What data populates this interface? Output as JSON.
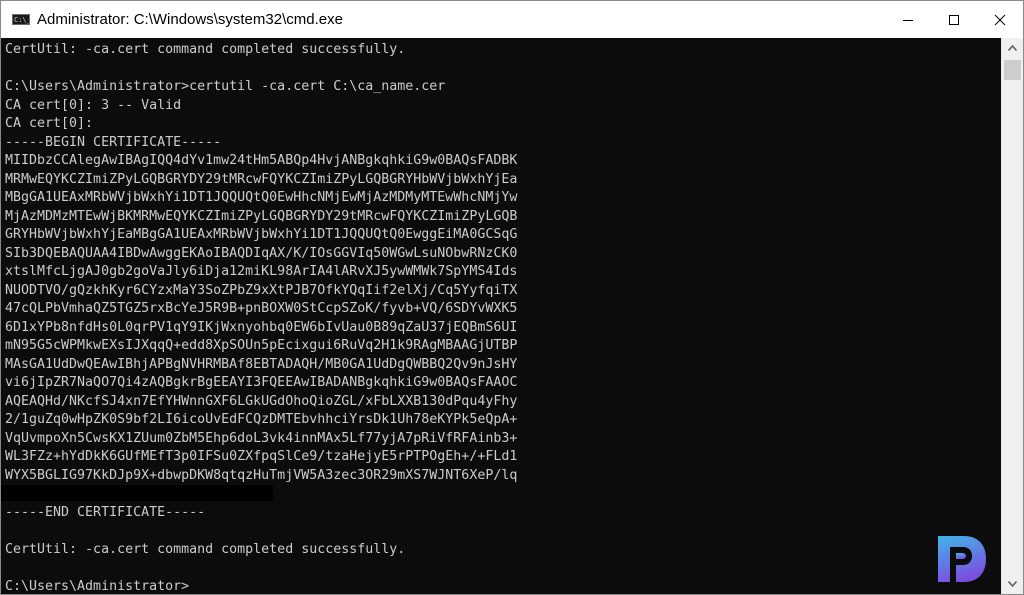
{
  "window": {
    "title": "Administrator: C:\\Windows\\system32\\cmd.exe",
    "app_icon_label": "C:\\_",
    "controls": {
      "minimize": "minimize-icon",
      "maximize": "maximize-icon",
      "close": "close-icon"
    }
  },
  "console": {
    "lines": [
      "CertUtil: -ca.cert command completed successfully.",
      "",
      "C:\\Users\\Administrator>certutil -ca.cert C:\\ca_name.cer",
      "CA cert[0]: 3 -- Valid",
      "CA cert[0]:",
      "-----BEGIN CERTIFICATE-----",
      "MIIDbzCCAlegAwIBAgIQQ4dYv1mw24tHm5ABQp4HvjANBgkqhkiG9w0BAQsFADBK",
      "MRMwEQYKCZImiZPyLGQBGRYDY29tMRcwFQYKCZImiZPyLGQBGRYHbWVjbWxhYjEa",
      "MBgGA1UEAxMRbWVjbWxhYi1DT1JQQUQtQ0EwHhcNMjEwMjAzMDMyMTEwWhcNMjYw",
      "MjAzMDMzMTEwWjBKMRMwEQYKCZImiZPyLGQBGRYDY29tMRcwFQYKCZImiZPyLGQB",
      "GRYHbWVjbWxhYjEaMBgGA1UEAxMRbWVjbWxhYi1DT1JQQUQtQ0EwggEiMA0GCSqG",
      "SIb3DQEBAQUAA4IBDwAwggEKAoIBAQDIqAX/K/IOsGGVIq50WGwLsuNObwRNzCK0",
      "xtslMfcLjgAJ0gb2goVaJly6iDja12miKL98ArIA4lARvXJ5ywWMWk7SpYMS4Ids",
      "NUODTVO/gQzkhKyr6CYzxMaY3SoZPbZ9xXtPJB7OfkYQqIif2elXj/Cq5YyfqiTX",
      "47cQLPbVmhaQZ5TGZ5rxBcYeJ5R9B+pnBOXW0StCcpSZoK/fyvb+VQ/6SDYvWXK5",
      "6D1xYPb8nfdHs0L0qrPV1qY9IKjWxnyohbq0EW6bIvUau0B89qZaU37jEQBmS6UI",
      "mN95G5cWPMkwEXsIJXqqQ+edd8XpSOUn5pEcixgui6RuVq2H1k9RAgMBAAGjUTBP",
      "MAsGA1UdDwQEAwIBhjAPBgNVHRMBAf8EBTADAQH/MB0GA1UdDgQWBBQ2Qv9nJsHY",
      "vi6jIpZR7NaQO7Qi4zAQBgkrBgEEAYI3FQEEAwIBADANBgkqhkiG9w0BAQsFAAOC",
      "AQEAQHd/NKcfSJ4xn7EfYHWnnGXF6LGkUGdOhoQioZGL/xFbLXXB130dPqu4yFhy",
      "2/1guZq0wHpZK0S9bf2LI6icoUvEdFCQzDMTEbvhhciYrsDk1Uh78eKYPk5eQpA+",
      "VqUvmpoXn5CwsKX1ZUum0ZbM5Ehp6doL3vk4innMAx5Lf77yjA7pRiVfRFAinb3+",
      "WL3FZz+hYdDkK6GUfMEfT3p0IFSu0ZXfpqSlCe9/tzaHejyE5rPTPOgEh+/+FLd1",
      "WYX5BGLIG97KkDJp9X+dbwpDKW8qtqzHuTmjVW5A3zec3OR29mXS7WJNT6XeP/lq",
      "",
      "-----END CERTIFICATE-----",
      "",
      "CertUtil: -ca.cert command completed successfully.",
      "",
      "C:\\Users\\Administrator>"
    ]
  },
  "scrollbar": {
    "up_icon": "chevron-up-icon",
    "down_icon": "chevron-down-icon"
  },
  "watermark": {
    "logo_letter": "P",
    "colors": {
      "top": "#3fb6e8",
      "bottom": "#7b4fe0"
    }
  },
  "colors": {
    "console_bg": "#0c0c0c",
    "console_fg": "#cccccc",
    "titlebar_bg": "#ffffff"
  }
}
